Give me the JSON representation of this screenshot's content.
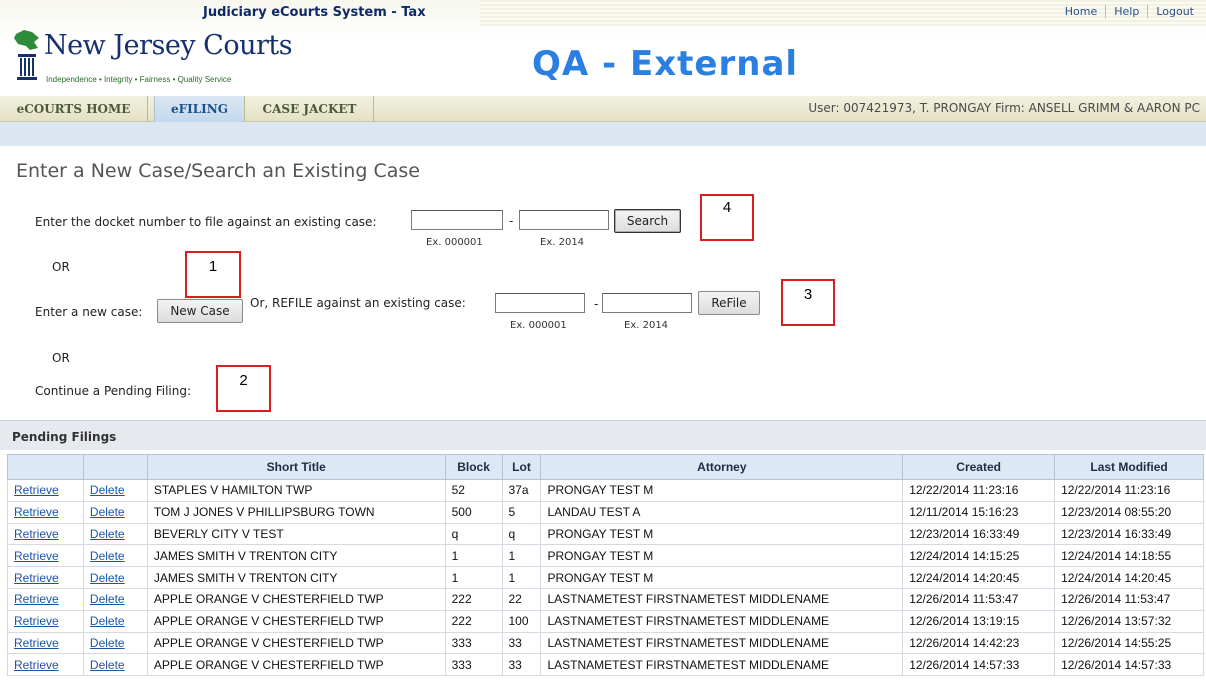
{
  "header": {
    "system_title": "Judiciary eCourts System - Tax",
    "links": [
      "Home",
      "Help",
      "Logout"
    ],
    "court_name": "New Jersey Courts",
    "court_tagline": "Independence • Integrity • Fairness • Quality Service",
    "environment": "QA - External"
  },
  "nav": {
    "tabs": [
      "eCOURTS HOME",
      "eFILING",
      "CASE JACKET"
    ],
    "active_tab": "eFILING",
    "user_info": "User: 007421973, T. PRONGAY  Firm: ANSELL GRIMM & AARON PC"
  },
  "page_title": "Enter a New Case/Search an Existing Case",
  "form": {
    "docket_label": "Enter the docket number to file against an existing case:",
    "docket_number_value": "",
    "docket_year_value": "",
    "hint_number": "Ex. 000001",
    "hint_year": "Ex. 2014",
    "dash": "-",
    "search_button": "Search",
    "or_1": "OR",
    "new_case_label": "Enter a new case:",
    "new_case_button": "New Case",
    "refile_label": "Or, REFILE against an existing case:",
    "refile_number_value": "",
    "refile_year_value": "",
    "refile_button": "ReFile",
    "or_2": "OR",
    "pending_label": "Continue a Pending Filing:"
  },
  "annotations": [
    "1",
    "2",
    "3",
    "4"
  ],
  "pending": {
    "title": "Pending Filings",
    "columns": [
      "",
      "",
      "Short Title",
      "Block",
      "Lot",
      "Attorney",
      "Created",
      "Last Modified"
    ],
    "retrieve_label": "Retrieve",
    "delete_label": "Delete",
    "rows": [
      {
        "title": "STAPLES V HAMILTON TWP",
        "block": "52",
        "lot": "37a",
        "attorney": "PRONGAY TEST M",
        "created": "12/22/2014 11:23:16",
        "modified": "12/22/2014 11:23:16"
      },
      {
        "title": "TOM J JONES V PHILLIPSBURG TOWN",
        "block": "500",
        "lot": "5",
        "attorney": "LANDAU TEST A",
        "created": "12/11/2014 15:16:23",
        "modified": "12/23/2014 08:55:20"
      },
      {
        "title": "BEVERLY CITY V TEST",
        "block": "q",
        "lot": "q",
        "attorney": "PRONGAY TEST M",
        "created": "12/23/2014 16:33:49",
        "modified": "12/23/2014 16:33:49"
      },
      {
        "title": "JAMES SMITH V TRENTON CITY",
        "block": "1",
        "lot": "1",
        "attorney": "PRONGAY TEST M",
        "created": "12/24/2014 14:15:25",
        "modified": "12/24/2014 14:18:55"
      },
      {
        "title": "JAMES SMITH V TRENTON CITY",
        "block": "1",
        "lot": "1",
        "attorney": "PRONGAY TEST M",
        "created": "12/24/2014 14:20:45",
        "modified": "12/24/2014 14:20:45"
      },
      {
        "title": "APPLE ORANGE V CHESTERFIELD TWP",
        "block": "222",
        "lot": "22",
        "attorney": "LASTNAMETEST FIRSTNAMETEST MIDDLENAME",
        "created": "12/26/2014 11:53:47",
        "modified": "12/26/2014 11:53:47"
      },
      {
        "title": "APPLE ORANGE V CHESTERFIELD TWP",
        "block": "222",
        "lot": "100",
        "attorney": "LASTNAMETEST FIRSTNAMETEST MIDDLENAME",
        "created": "12/26/2014 13:19:15",
        "modified": "12/26/2014 13:57:32"
      },
      {
        "title": "APPLE ORANGE V CHESTERFIELD TWP",
        "block": "333",
        "lot": "33",
        "attorney": "LASTNAMETEST FIRSTNAMETEST MIDDLENAME",
        "created": "12/26/2014 14:42:23",
        "modified": "12/26/2014 14:55:25"
      },
      {
        "title": "APPLE ORANGE V CHESTERFIELD TWP",
        "block": "333",
        "lot": "33",
        "attorney": "LASTNAMETEST FIRSTNAMETEST MIDDLENAME",
        "created": "12/26/2014 14:57:33",
        "modified": "12/26/2014 14:57:33"
      }
    ]
  }
}
